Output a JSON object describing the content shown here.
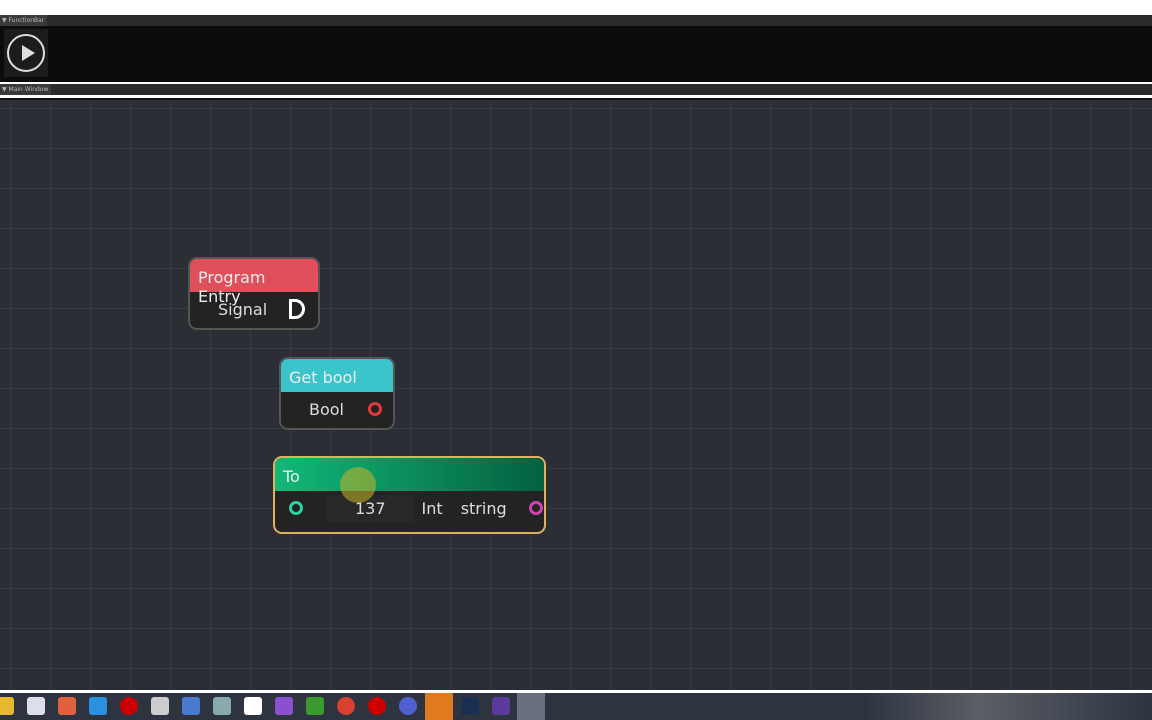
{
  "function_bar": {
    "title": "FunctionBar",
    "play_icon": "play-icon"
  },
  "main_window": {
    "title": "Main Window"
  },
  "nodes": {
    "program_entry": {
      "title": "Program Entry",
      "output_label": "Signal",
      "header_color": "#e0505a"
    },
    "get_bool": {
      "title": "Get bool",
      "output_label": "Bool",
      "header_color": "#3cc4cc"
    },
    "to": {
      "title": "To",
      "input_value": "137",
      "from_type": "Int",
      "to_type": "string",
      "header_color": "#0fa870"
    }
  },
  "taskbar": {
    "icons": [
      "file-explorer",
      "store",
      "app",
      "mail",
      "recorder",
      "paint",
      "remote-desktop",
      "calculator",
      "notepad",
      "visual-studio",
      "minecraft",
      "chrome",
      "obs",
      "discord",
      "app-orange",
      "steam",
      "terminal",
      "active-app"
    ]
  }
}
